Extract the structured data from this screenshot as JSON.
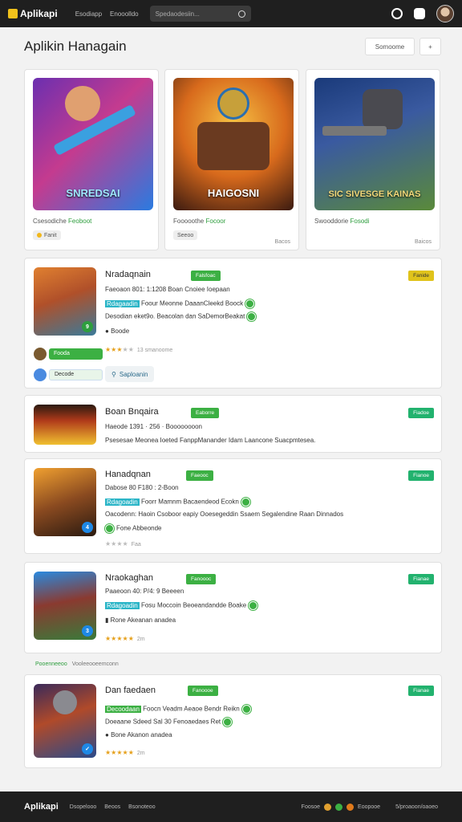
{
  "topbar": {
    "app_name": "Aplikapi",
    "nav": [
      "Esodiapp",
      "Enooolldo"
    ],
    "search_placeholder": "Spedaodesiin..."
  },
  "header": {
    "title": "Aplikin Hanagain",
    "button_label": "Somoome",
    "add_label": "+"
  },
  "featured": [
    {
      "art_title": "SNREDSAI",
      "meta_left": "Csesodiche",
      "meta_right": "Feoboot",
      "pill": "Fanit",
      "size": ""
    },
    {
      "art_title": "HAIGOSNI",
      "meta_left": "Fooooothe",
      "meta_right": "Focoor",
      "pill": "Seeoo",
      "size": "Bacos"
    },
    {
      "art_title": "SIC SIVESGE KAINAS",
      "meta_left": "Swooddorie",
      "meta_right": "Fosodi",
      "pill": "",
      "size": "Baicos"
    }
  ],
  "list": [
    {
      "title": "Nradaqnain",
      "tag": "Falsfoac",
      "right_tag": "Fanide",
      "line1": "Faeoaon 801: 1:1208 Boan Cnoiee Ioepaan",
      "line2_hl": "Rdagaadin",
      "line2": "Foour  Meonne DaaanCleekd Boock",
      "line3": "Desodian eket9o. Beacolan dan SaDemorBeakat",
      "line4": "Boode",
      "rating_meta": "13 smanoome",
      "mini1": "Fooda",
      "mini2": "Decode",
      "button": "Saploanin"
    },
    {
      "title": "Boan Bnqaira",
      "tag": "Eaborre",
      "right_tag": "Fiadoe",
      "line1": "Haeode 1391 · 256 · Boooooooon",
      "line2": "Psesesae Meonea Ioeted FanppManander Idam Laancone Suacpmtesea."
    },
    {
      "title": "Hanadqnan",
      "tag": "Faeooc",
      "right_tag": "Fianoe",
      "line1": "Dabose 80 F180 : 2-Boon",
      "line2_hl": "Rdagoadin",
      "line2": "Foorr  Mamnm Bacaendeod Ecokn",
      "line3": "Oacodenn: Haoin  Csoboor eapiy  Ooesegeddin Ssaem  Segalendine Raan Dinnados",
      "line4": "Fone Abbeonde",
      "rating_meta": "Faa"
    },
    {
      "title": "Nraokaghan",
      "tag": "Fanoooc",
      "right_tag": "Fianae",
      "line1": "Paaeoon 40: P/4: 9 Beeeen",
      "line2_hl": "Rdagoadin",
      "line2": "Fosu  Moccoin Beoeandandde Boake",
      "line4": "Rone Akeanan anadea",
      "rating_meta": "2m"
    },
    {
      "title": "Dan faedaen",
      "tag": "Fanoooe",
      "right_tag": "Fianae",
      "line1": "",
      "line2_hl": "Decoodaan",
      "line2": "Foocn  Veadm  Aeaoe Bendr Reikn",
      "line3": "Doeaane Sdeed  Sal 30 Fenoaedaes Ret",
      "line4": "Bone Akanon anadea",
      "rating_meta": "2m"
    }
  ],
  "section": {
    "label": "Pooenneeoo",
    "sub": "Vooleeooeemconn"
  },
  "footer": {
    "app_name": "Aplikapi",
    "links": [
      "Dsopelooo",
      "Beoos",
      "Bsonoteoo"
    ],
    "right1": "Foosoe",
    "right2": "Eoopooe",
    "right3": "5/proaoon/oaoeo"
  },
  "colors": {
    "accent_green": "#3cb043",
    "accent_teal": "#2bb5c7",
    "dark": "#1f1f1f",
    "star": "#e6a01b"
  }
}
